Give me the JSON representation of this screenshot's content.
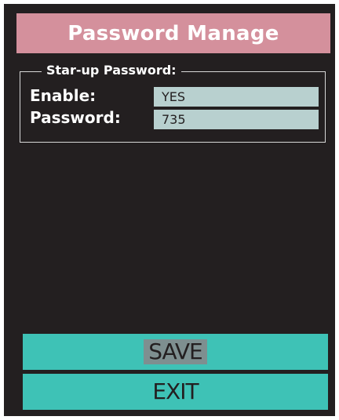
{
  "header": {
    "title": "Password Manage"
  },
  "startup_group": {
    "legend": "Star-up Password:",
    "enable_label": "Enable:",
    "enable_value": "YES",
    "password_label": "Password:",
    "password_value": "735"
  },
  "actions": {
    "save_label": "SAVE",
    "exit_label": "EXIT"
  },
  "colors": {
    "background": "#231f20",
    "title_bar": "#d4909c",
    "field_fill": "#b8d0cf",
    "button_fill": "#3ec2b6",
    "selected_highlight": "#7e8f90"
  }
}
